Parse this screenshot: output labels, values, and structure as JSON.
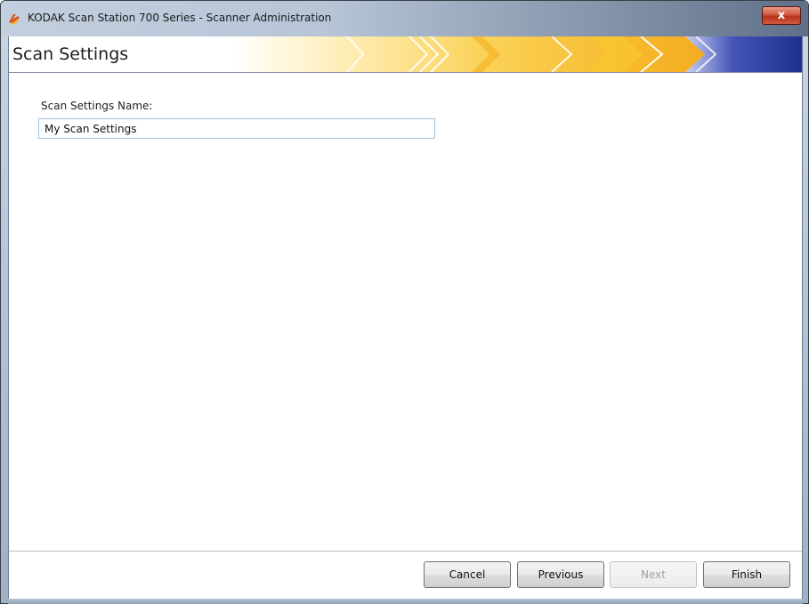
{
  "window": {
    "title": "KODAK Scan Station 700 Series - Scanner Administration",
    "close_glyph": "x",
    "close_color": "#c9452b"
  },
  "page": {
    "title": "Scan Settings"
  },
  "form": {
    "name_label": "Scan Settings Name:",
    "name_value": "My Scan Settings"
  },
  "buttons": {
    "cancel": "Cancel",
    "previous": "Previous",
    "next": "Next",
    "next_enabled": false,
    "finish": "Finish"
  },
  "theme": {
    "banner_yellow": "#f9c928",
    "banner_orange": "#f5a623",
    "banner_blue": "#1f2f8c"
  },
  "icons": {
    "app": "kodak-logo-icon",
    "close": "close-icon"
  }
}
